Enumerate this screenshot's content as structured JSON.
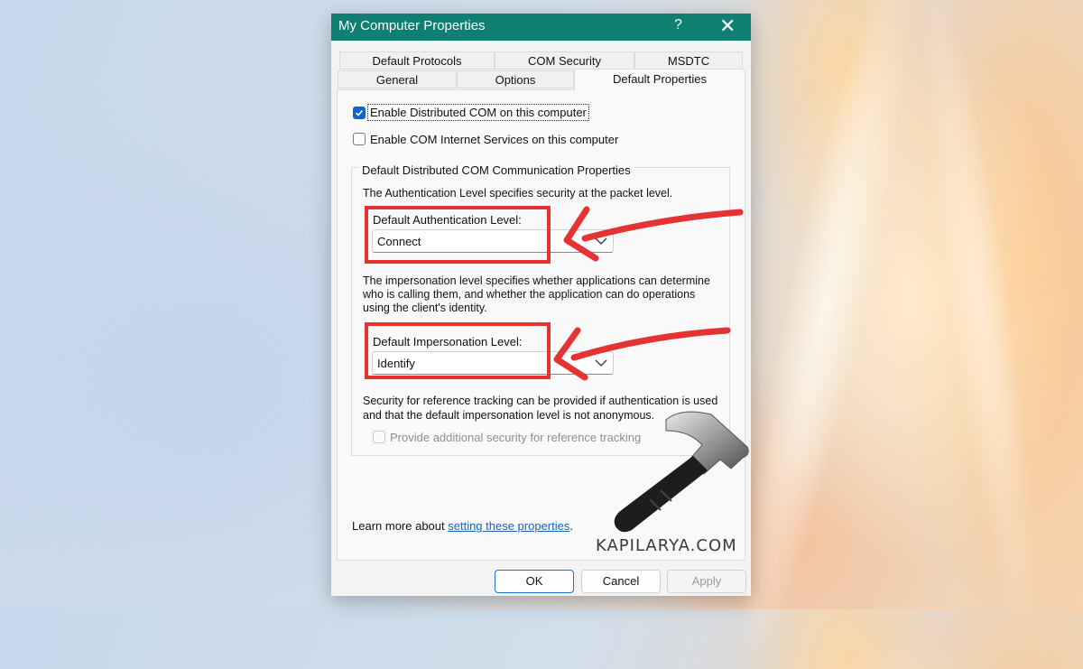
{
  "window": {
    "title": "My Computer Properties",
    "help_glyph": "?",
    "close_glyph": "✕",
    "titlebar_color": "#0f7f72"
  },
  "tabs": {
    "row1": [
      "Default Protocols",
      "COM Security",
      "MSDTC"
    ],
    "row2": [
      "General",
      "Options",
      "Default Properties"
    ],
    "active": "Default Properties"
  },
  "options": {
    "enable_dcom": {
      "label": "Enable Distributed COM on this computer",
      "checked": true
    },
    "enable_internet": {
      "label": "Enable COM Internet Services on this computer",
      "checked": false
    }
  },
  "group": {
    "title": "Default Distributed COM Communication Properties",
    "auth_desc": "The Authentication Level specifies security at the packet level.",
    "auth_label": "Default Authentication Level:",
    "auth_value": "Connect",
    "imp_desc_1": "The impersonation level specifies whether applications can determine",
    "imp_desc_2": "who is calling them, and whether the application can do operations",
    "imp_desc_3": "using the client's identity.",
    "imp_label": "Default Impersonation Level:",
    "imp_value": "Identify",
    "sec_desc_1": "Security for reference tracking can be provided if authentication is used",
    "sec_desc_2": "and that the default impersonation level is not anonymous.",
    "ref_tracking": {
      "label": "Provide additional security for reference tracking",
      "checked": false,
      "enabled": false
    }
  },
  "learn_more": {
    "prefix": "Learn more about ",
    "link": "setting these properties",
    "suffix": "."
  },
  "buttons": {
    "ok": "OK",
    "cancel": "Cancel",
    "apply": "Apply"
  },
  "annotation_color": "#e53232",
  "watermark": "KAPILARYA.COM"
}
